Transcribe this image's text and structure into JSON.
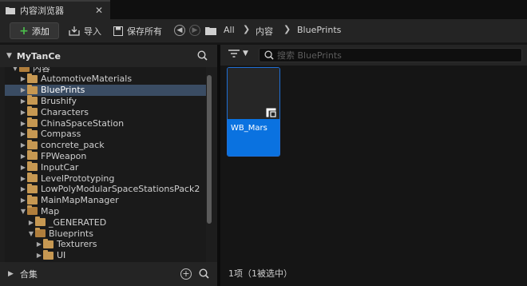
{
  "window": {
    "tab_title": "内容浏览器",
    "close_glyph": "✕"
  },
  "toolbar": {
    "add_label": "添加",
    "import_label": "导入",
    "save_all_label": "保存所有",
    "breadcrumbs": [
      "All",
      "内容",
      "BluePrints"
    ]
  },
  "sources": {
    "root_name": "MyTanCe",
    "tree": [
      {
        "label": "内容",
        "depth": 0,
        "expanded": true,
        "selected": false
      },
      {
        "label": "AutomotiveMaterials",
        "depth": 1,
        "expanded": false,
        "selected": false
      },
      {
        "label": "BluePrints",
        "depth": 1,
        "expanded": false,
        "selected": true
      },
      {
        "label": "Brushify",
        "depth": 1,
        "expanded": false,
        "selected": false
      },
      {
        "label": "Characters",
        "depth": 1,
        "expanded": false,
        "selected": false
      },
      {
        "label": "ChinaSpaceStation",
        "depth": 1,
        "expanded": false,
        "selected": false
      },
      {
        "label": "Compass",
        "depth": 1,
        "expanded": false,
        "selected": false
      },
      {
        "label": "concrete_pack",
        "depth": 1,
        "expanded": false,
        "selected": false
      },
      {
        "label": "FPWeapon",
        "depth": 1,
        "expanded": false,
        "selected": false
      },
      {
        "label": "InputCar",
        "depth": 1,
        "expanded": false,
        "selected": false
      },
      {
        "label": "LevelPrototyping",
        "depth": 1,
        "expanded": false,
        "selected": false
      },
      {
        "label": "LowPolyModularSpaceStationsPack2",
        "depth": 1,
        "expanded": false,
        "selected": false
      },
      {
        "label": "MainMapManager",
        "depth": 1,
        "expanded": false,
        "selected": false
      },
      {
        "label": "Map",
        "depth": 1,
        "expanded": true,
        "selected": false
      },
      {
        "label": "_GENERATED",
        "depth": 2,
        "expanded": false,
        "selected": false
      },
      {
        "label": "Blueprints",
        "depth": 2,
        "expanded": true,
        "selected": false
      },
      {
        "label": "Texturers",
        "depth": 3,
        "expanded": false,
        "selected": false
      },
      {
        "label": "UI",
        "depth": 3,
        "expanded": false,
        "selected": false
      }
    ],
    "collections_label": "合集"
  },
  "content": {
    "search_placeholder": "搜索 BluePrints",
    "assets": [
      {
        "name": "WB_Mars",
        "selected": true
      }
    ],
    "status_text": "1项（1被选中）"
  },
  "colors": {
    "selection": "#3a4c63",
    "asset_highlight": "#0a72e0",
    "folder": "#c69852",
    "add_plus": "#4cc04c"
  }
}
